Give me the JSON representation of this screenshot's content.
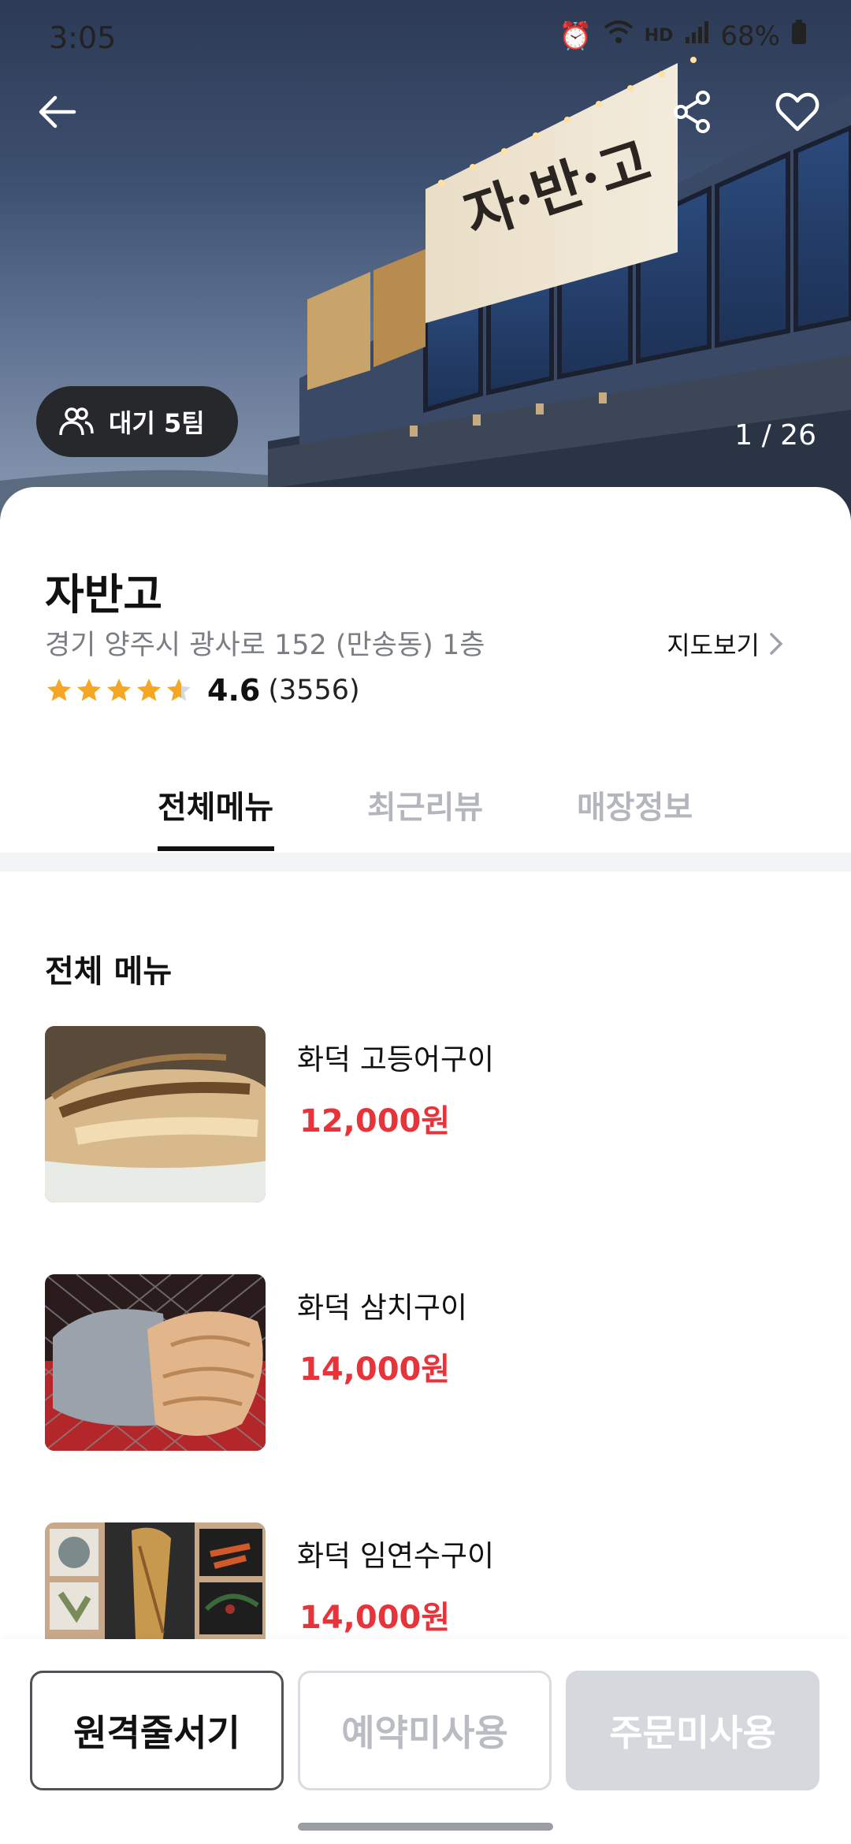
{
  "status_bar": {
    "time": "3:05",
    "battery": "68%",
    "icons": [
      "alarm-icon",
      "wifi-icon",
      "hd-voice-icon",
      "signal-icon",
      "battery-icon"
    ]
  },
  "hero": {
    "wait_badge": "대기 5팀",
    "photo_counter": "1 / 26",
    "icons": [
      "back-arrow-icon",
      "share-icon",
      "heart-icon",
      "people-icon"
    ]
  },
  "store": {
    "name": "자반고",
    "address": "경기 양주시 광사로 152 (만송동) 1층",
    "map_link": "지도보기",
    "rating": 4.6,
    "rating_text": "4.6",
    "review_count": "(3556)"
  },
  "tabs": [
    {
      "label": "전체메뉴",
      "active": true
    },
    {
      "label": "최근리뷰",
      "active": false
    },
    {
      "label": "매장정보",
      "active": false
    }
  ],
  "menu": {
    "section_title": "전체 메뉴",
    "items": [
      {
        "name": "화덕 고등어구이",
        "price": "12,000원"
      },
      {
        "name": "화덕 삼치구이",
        "price": "14,000원"
      },
      {
        "name": "화덕 임연수구이",
        "price": "14,000원"
      }
    ]
  },
  "actions": {
    "remote_queue": "원격줄서기",
    "reservation": "예약미사용",
    "order": "주문미사용"
  },
  "colors": {
    "price": "#e8333a",
    "star": "#f5a623",
    "active_tab": "#111111",
    "inactive_tab": "#b3b7bd"
  }
}
